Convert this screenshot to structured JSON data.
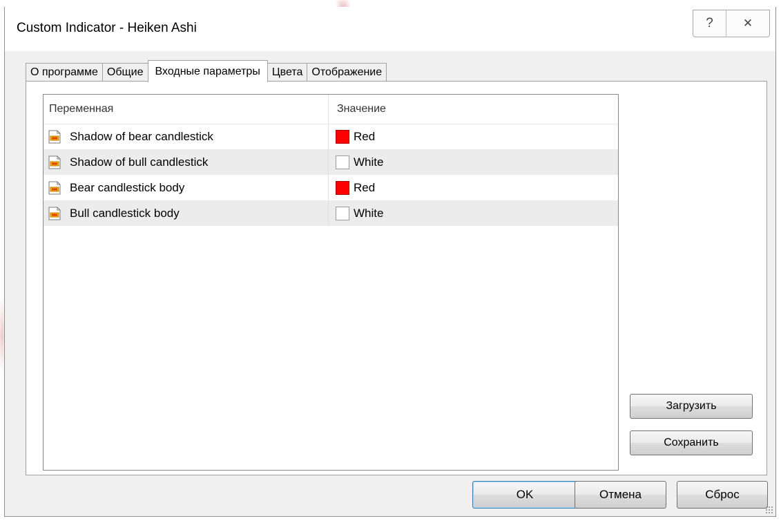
{
  "window": {
    "title": "Custom Indicator - Heiken Ashi",
    "help_glyph": "?",
    "close_glyph": "✕"
  },
  "tabs": [
    {
      "label": "О программе",
      "active": false
    },
    {
      "label": "Общие",
      "active": false
    },
    {
      "label": "Входные параметры",
      "active": true
    },
    {
      "label": "Цвета",
      "active": false
    },
    {
      "label": "Отображение",
      "active": false
    }
  ],
  "grid": {
    "columns": [
      "Переменная",
      "Значение"
    ],
    "rows": [
      {
        "variable": "Shadow of bear candlestick",
        "value": "Red",
        "color": "#ff0000"
      },
      {
        "variable": "Shadow of bull candlestick",
        "value": "White",
        "color": "#ffffff"
      },
      {
        "variable": "Bear candlestick body",
        "value": "Red",
        "color": "#ff0000"
      },
      {
        "variable": "Bull candlestick body",
        "value": "White",
        "color": "#ffffff"
      }
    ]
  },
  "side_buttons": {
    "load_label": "Загрузить",
    "save_label": "Сохранить"
  },
  "footer": {
    "ok_label": "OK",
    "cancel_label": "Отмена",
    "reset_label": "Сброс"
  }
}
